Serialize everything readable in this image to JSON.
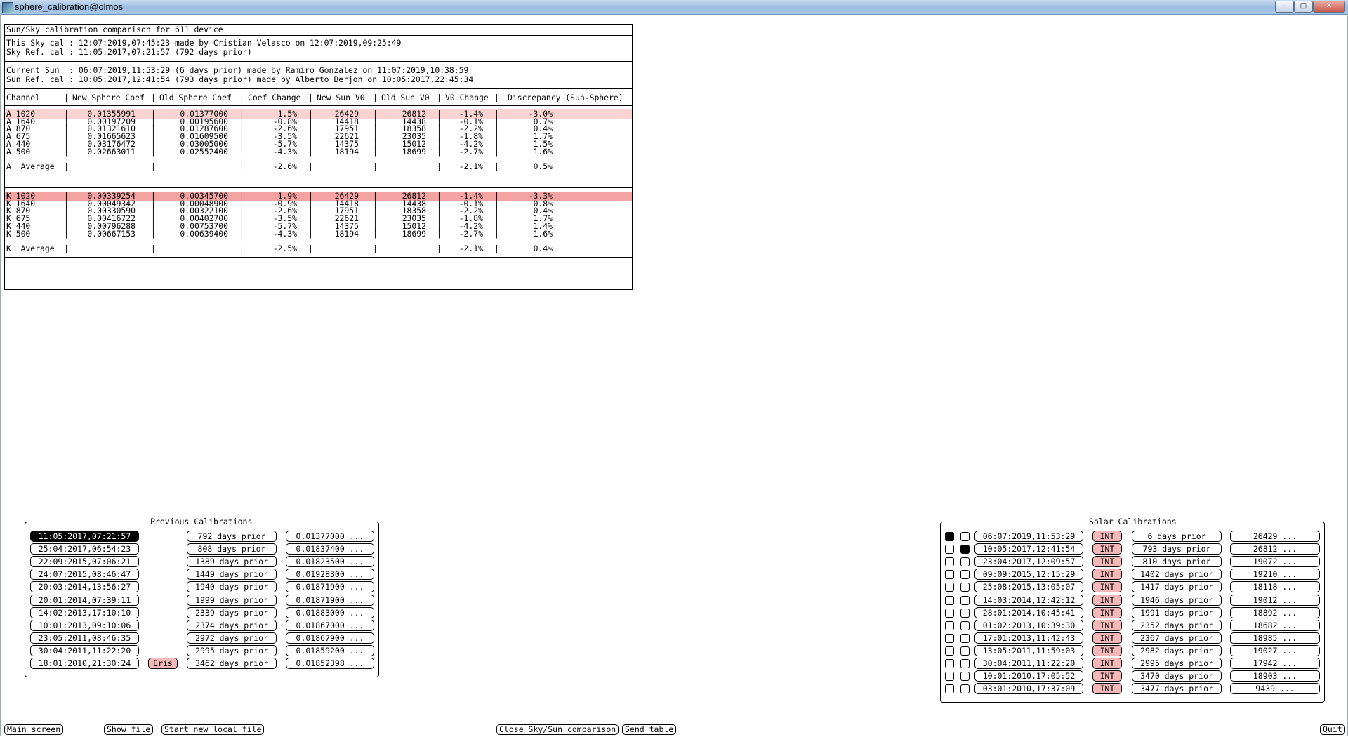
{
  "window": {
    "title": "sphere_calibration@olmos",
    "minimize": "–",
    "maximize": "□",
    "close": "✕"
  },
  "comparison": {
    "title": "Sun/Sky calibration comparison for 611 device",
    "sky_cal": "This Sky cal : 12:07:2019,07:45:23 made by Cristian Velasco on 12:07:2019,09:25:49",
    "sky_ref": "Sky Ref. cal : 11:05:2017,07:21:57 (792 days prior)",
    "current_sun": "Current Sun  : 06:07:2019,11:53:29 (6 days prior) made by Ramiro Gonzalez on 11:07:2019,10:38:59",
    "sun_ref": "Sun Ref. cal : 10:05:2017,12:41:54 (793 days prior) made by Alberto Berjon on 10:05:2017,22:45:34",
    "headers": [
      "Channel",
      "New Sphere Coef",
      "Old Sphere Coef",
      "Coef Change",
      "New Sun V0",
      "Old Sun V0",
      "V0 Change",
      "Discrepancy (Sun-Sphere)"
    ],
    "group_a": [
      {
        "channel": "A 1020",
        "new_coef": "0.01355991",
        "old_coef": "0.01377000",
        "coef_change": "1.5%",
        "new_v0": "26429",
        "old_v0": "26812",
        "v0_change": "-1.4%",
        "discrepancy": "-3.0%"
      },
      {
        "channel": "A 1640",
        "new_coef": "0.00197209",
        "old_coef": "0.00195600",
        "coef_change": "-0.8%",
        "new_v0": "14418",
        "old_v0": "14438",
        "v0_change": "-0.1%",
        "discrepancy": "0.7%"
      },
      {
        "channel": "A 870",
        "new_coef": "0.01321610",
        "old_coef": "0.01287600",
        "coef_change": "-2.6%",
        "new_v0": "17951",
        "old_v0": "18358",
        "v0_change": "-2.2%",
        "discrepancy": "0.4%"
      },
      {
        "channel": "A 675",
        "new_coef": "0.01665623",
        "old_coef": "0.01609500",
        "coef_change": "-3.5%",
        "new_v0": "22621",
        "old_v0": "23035",
        "v0_change": "-1.8%",
        "discrepancy": "1.7%"
      },
      {
        "channel": "A 440",
        "new_coef": "0.03176472",
        "old_coef": "0.03005000",
        "coef_change": "-5.7%",
        "new_v0": "14375",
        "old_v0": "15012",
        "v0_change": "-4.2%",
        "discrepancy": "1.5%"
      },
      {
        "channel": "A 500",
        "new_coef": "0.02663011",
        "old_coef": "0.02552400",
        "coef_change": "-4.3%",
        "new_v0": "18194",
        "old_v0": "18699",
        "v0_change": "-2.7%",
        "discrepancy": "1.6%"
      }
    ],
    "avg_a": {
      "channel": "A  Average",
      "coef_change": "-2.6%",
      "v0_change": "-2.1%",
      "discrepancy": "0.5%"
    },
    "group_k": [
      {
        "channel": "K 1020",
        "new_coef": "0.00339254",
        "old_coef": "0.00345700",
        "coef_change": "1.9%",
        "new_v0": "26429",
        "old_v0": "26812",
        "v0_change": "-1.4%",
        "discrepancy": "-3.3%"
      },
      {
        "channel": "K 1640",
        "new_coef": "0.00049342",
        "old_coef": "0.00048900",
        "coef_change": "-0.9%",
        "new_v0": "14418",
        "old_v0": "14438",
        "v0_change": "-0.1%",
        "discrepancy": "0.8%"
      },
      {
        "channel": "K 870",
        "new_coef": "0.00330590",
        "old_coef": "0.00322100",
        "coef_change": "-2.6%",
        "new_v0": "17951",
        "old_v0": "18358",
        "v0_change": "-2.2%",
        "discrepancy": "0.4%"
      },
      {
        "channel": "K 675",
        "new_coef": "0.00416722",
        "old_coef": "0.00402700",
        "coef_change": "-3.5%",
        "new_v0": "22621",
        "old_v0": "23035",
        "v0_change": "-1.8%",
        "discrepancy": "1.7%"
      },
      {
        "channel": "K 440",
        "new_coef": "0.00796288",
        "old_coef": "0.00753700",
        "coef_change": "-5.7%",
        "new_v0": "14375",
        "old_v0": "15012",
        "v0_change": "-4.2%",
        "discrepancy": "1.4%"
      },
      {
        "channel": "K 500",
        "new_coef": "0.00667153",
        "old_coef": "0.00639400",
        "coef_change": "-4.3%",
        "new_v0": "18194",
        "old_v0": "18699",
        "v0_change": "-2.7%",
        "discrepancy": "1.6%"
      }
    ],
    "avg_k": {
      "channel": "K  Average",
      "coef_change": "-2.5%",
      "v0_change": "-2.1%",
      "discrepancy": "0.4%"
    }
  },
  "previous": {
    "title": "Previous Calibrations",
    "items": [
      {
        "date": "11:05:2017,07:21:57",
        "tag": "",
        "prior": "792 days prior",
        "coef": "0.01377000 ...",
        "selected": true
      },
      {
        "date": "25:04:2017,06:54:23",
        "tag": "",
        "prior": "808 days prior",
        "coef": "0.01837400 ...",
        "selected": false
      },
      {
        "date": "22:09:2015,07:06:21",
        "tag": "",
        "prior": "1389 days prior",
        "coef": "0.01823500 ...",
        "selected": false
      },
      {
        "date": "24:07:2015,08:46:47",
        "tag": "",
        "prior": "1449 days prior",
        "coef": "0.01928300 ...",
        "selected": false
      },
      {
        "date": "20:03:2014,13:56:27",
        "tag": "",
        "prior": "1940 days prior",
        "coef": "0.01871900 ...",
        "selected": false
      },
      {
        "date": "20:01:2014,07:39:11",
        "tag": "",
        "prior": "1999 days prior",
        "coef": "0.01871900 ...",
        "selected": false
      },
      {
        "date": "14:02:2013,17:10:10",
        "tag": "",
        "prior": "2339 days prior",
        "coef": "0.01883000 ...",
        "selected": false
      },
      {
        "date": "10:01:2013,09:10:06",
        "tag": "",
        "prior": "2374 days prior",
        "coef": "0.01867000 ...",
        "selected": false
      },
      {
        "date": "23:05:2011,08:46:35",
        "tag": "",
        "prior": "2972 days prior",
        "coef": "0.01867900 ...",
        "selected": false
      },
      {
        "date": "30:04:2011,11:22:20",
        "tag": "",
        "prior": "2995 days prior",
        "coef": "0.01859200 ...",
        "selected": false
      },
      {
        "date": "18:01:2010,21:30:24",
        "tag": "Eris",
        "prior": "3462 days prior",
        "coef": "0.01852398 ...",
        "selected": false
      }
    ]
  },
  "solar": {
    "title": "Solar Calibrations",
    "items": [
      {
        "r1": true,
        "r2": false,
        "date": "06:07:2019,11:53:29",
        "type": "INT",
        "prior": "6 days prior",
        "v0": "26429 ..."
      },
      {
        "r1": false,
        "r2": true,
        "date": "10:05:2017,12:41:54",
        "type": "INT",
        "prior": "793 days prior",
        "v0": "26812 ..."
      },
      {
        "r1": false,
        "r2": false,
        "date": "23:04:2017,12:09:57",
        "type": "INT",
        "prior": "810 days prior",
        "v0": "19072 ..."
      },
      {
        "r1": false,
        "r2": false,
        "date": "09:09:2015,12:15:29",
        "type": "INT",
        "prior": "1402 days prior",
        "v0": "19210 ..."
      },
      {
        "r1": false,
        "r2": false,
        "date": "25:08:2015,13:05:07",
        "type": "INT",
        "prior": "1417 days prior",
        "v0": "18118 ..."
      },
      {
        "r1": false,
        "r2": false,
        "date": "14:03:2014,12:42:12",
        "type": "INT",
        "prior": "1946 days prior",
        "v0": "19012 ..."
      },
      {
        "r1": false,
        "r2": false,
        "date": "28:01:2014,10:45:41",
        "type": "INT",
        "prior": "1991 days prior",
        "v0": "18892 ..."
      },
      {
        "r1": false,
        "r2": false,
        "date": "01:02:2013,10:39:30",
        "type": "INT",
        "prior": "2352 days prior",
        "v0": "18682 ..."
      },
      {
        "r1": false,
        "r2": false,
        "date": "17:01:2013,11:42:43",
        "type": "INT",
        "prior": "2367 days prior",
        "v0": "18985 ..."
      },
      {
        "r1": false,
        "r2": false,
        "date": "13:05:2011,11:59:03",
        "type": "INT",
        "prior": "2982 days prior",
        "v0": "19027 ..."
      },
      {
        "r1": false,
        "r2": false,
        "date": "30:04:2011,11:22:20",
        "type": "INT",
        "prior": "2995 days prior",
        "v0": "17942 ..."
      },
      {
        "r1": false,
        "r2": false,
        "date": "10:01:2010,17:05:52",
        "type": "INT",
        "prior": "3470 days prior",
        "v0": "18903 ..."
      },
      {
        "r1": false,
        "r2": false,
        "date": "03:01:2010,17:37:09",
        "type": "INT",
        "prior": "3477 days prior",
        "v0": "9439 ..."
      }
    ]
  },
  "buttons": {
    "main_screen": "Main screen",
    "show_file": "Show file",
    "start_new_local_file": "Start new local file",
    "close_comparison": "Close Sky/Sun comparison",
    "send_table": "Send table",
    "quit": "Quit"
  },
  "colors": {
    "highlight_light": "#fcd3d3",
    "highlight_strong": "#f4a3a3",
    "tag_fill": "#f4b8b8",
    "selected_fill": "#000000"
  }
}
